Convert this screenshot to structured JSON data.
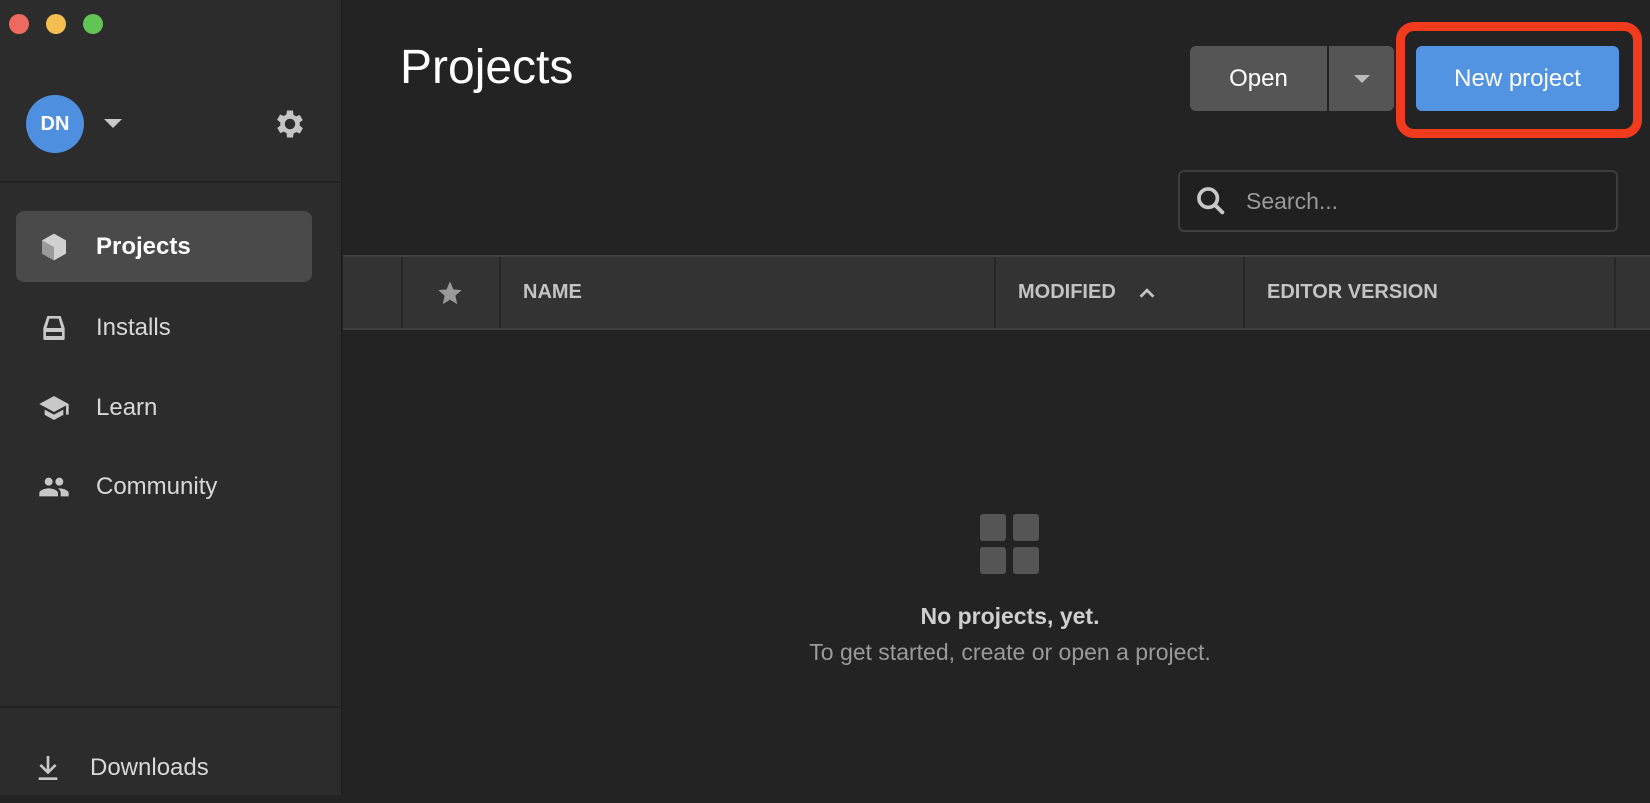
{
  "window": {
    "traffic_lights": {
      "close": "#ee6a5e",
      "minimize": "#f5bf4f",
      "zoom": "#61c454"
    }
  },
  "sidebar": {
    "user": {
      "initials": "DN",
      "avatar_color": "#4f8fe0"
    },
    "items": [
      {
        "label": "Projects",
        "icon": "cube-icon",
        "active": true
      },
      {
        "label": "Installs",
        "icon": "drive-icon",
        "active": false
      },
      {
        "label": "Learn",
        "icon": "graduation-cap-icon",
        "active": false
      },
      {
        "label": "Community",
        "icon": "people-icon",
        "active": false
      }
    ],
    "downloads": {
      "label": "Downloads",
      "icon": "download-icon"
    }
  },
  "main": {
    "title": "Projects",
    "open_label": "Open",
    "new_project_label": "New project",
    "accent": "#5294e2",
    "highlight_color": "#f23a1c",
    "search": {
      "placeholder": "Search...",
      "value": ""
    },
    "columns": [
      {
        "label": "NAME"
      },
      {
        "label": "MODIFIED",
        "sort": "ascending"
      },
      {
        "label": "EDITOR VERSION"
      }
    ],
    "empty": {
      "title": "No projects, yet.",
      "subtitle": "To get started, create or open a project."
    }
  }
}
